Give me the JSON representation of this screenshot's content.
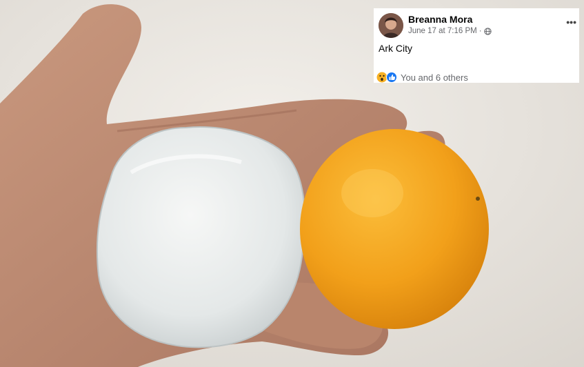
{
  "post": {
    "author": "Breanna Mora",
    "timestamp": "June 17 at 7:16 PM",
    "separator": "·",
    "privacy_icon": "globe-icon",
    "more_label": "•••",
    "text": "Ark City",
    "reactions": {
      "icons": [
        "wow-reaction-icon",
        "like-reaction-icon"
      ],
      "summary": "You and 6 others"
    }
  },
  "photo": {
    "subjects": [
      "hand",
      "hailstone",
      "orange"
    ]
  },
  "colors": {
    "card_bg": "#ffffff",
    "name_text": "#050505",
    "meta_text": "#65676b",
    "like_blue": "#1877f2",
    "wow_yellow": "#f7b125",
    "orange": "#f3a21c",
    "hailstone": "#e8ecee"
  }
}
